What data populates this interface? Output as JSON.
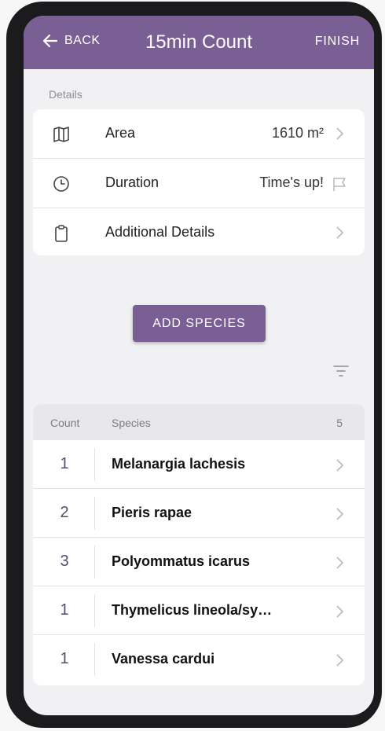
{
  "header": {
    "back_label": "BACK",
    "title": "15min Count",
    "finish_label": "FINISH",
    "color": "#7a5f95"
  },
  "details": {
    "section_label": "Details",
    "rows": [
      {
        "icon": "map-icon",
        "label": "Area",
        "value": "1610 m²"
      },
      {
        "icon": "clock-icon",
        "label": "Duration",
        "value": "Time's up!"
      },
      {
        "icon": "clipboard-icon",
        "label": "Additional Details",
        "value": ""
      }
    ]
  },
  "add_species_label": "ADD SPECIES",
  "species_list": {
    "header": {
      "count_label": "Count",
      "species_label": "Species",
      "total": "5"
    },
    "rows": [
      {
        "count": "1",
        "name": "Melanargia lachesis"
      },
      {
        "count": "2",
        "name": "Pieris rapae"
      },
      {
        "count": "3",
        "name": "Polyommatus icarus"
      },
      {
        "count": "1",
        "name": "Thymelicus lineola/sy…"
      },
      {
        "count": "1",
        "name": "Vanessa cardui"
      }
    ]
  }
}
